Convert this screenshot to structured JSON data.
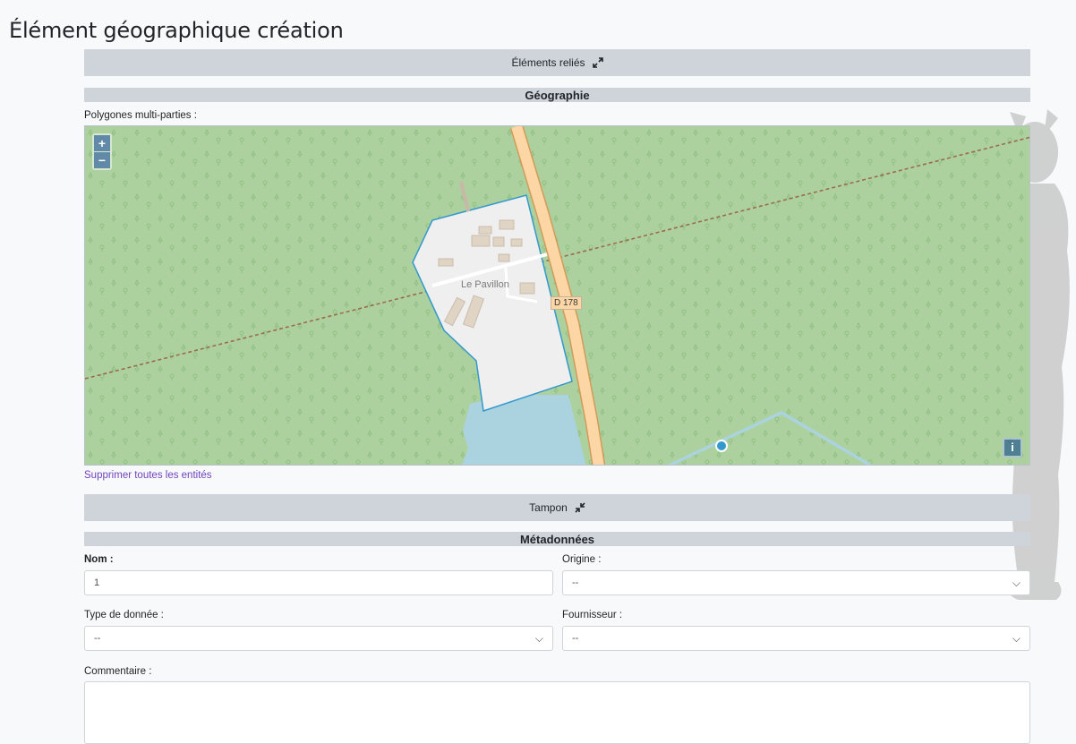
{
  "page": {
    "title": "Élément géographique création"
  },
  "linked_elements": {
    "label": "Éléments reliés",
    "icon": "expand-icon"
  },
  "geography": {
    "header": "Géographie",
    "polygons_label": "Polygones multi-parties :",
    "map": {
      "place_label": "Le Pavillon",
      "road_label": "D 178",
      "zoom_in": "+",
      "zoom_out": "−",
      "info": "i"
    },
    "delete_all_link": "Supprimer toutes les entités"
  },
  "buffer": {
    "label": "Tampon",
    "icon": "collapse-icon"
  },
  "metadata": {
    "header": "Métadonnées",
    "name_label": "Nom :",
    "name_value": "1",
    "origin_label": "Origine :",
    "origin_value": "--",
    "data_type_label": "Type de donnée :",
    "data_type_value": "--",
    "provider_label": "Fournisseur :",
    "provider_value": "--",
    "comment_label": "Commentaire :"
  },
  "colors": {
    "forest": "#add19e",
    "road": "#fcd6a4",
    "water": "#aad3df",
    "polygon_stroke": "#3399cc",
    "link": "#6f42c1"
  }
}
